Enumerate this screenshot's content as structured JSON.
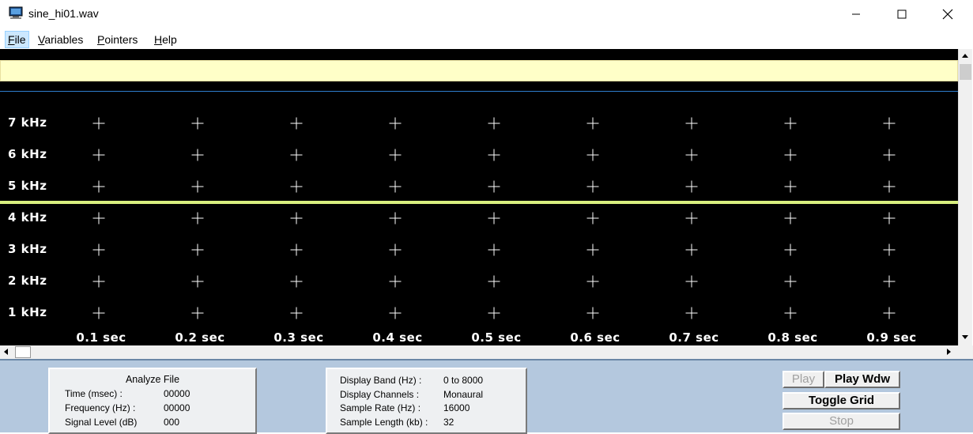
{
  "window": {
    "title": "sine_hi01.wav"
  },
  "menu": [
    {
      "label": "File",
      "ul": "F",
      "rest": "ile"
    },
    {
      "label": "Variables",
      "ul": "V",
      "rest": "ariables"
    },
    {
      "label": "Pointers",
      "ul": "P",
      "rest": "ointers"
    },
    {
      "label": "Help",
      "ul": "H",
      "rest": "elp"
    }
  ],
  "spectrogram": {
    "y_labels": [
      "7 kHz",
      "6 kHz",
      "5 kHz",
      "4 kHz",
      "3 kHz",
      "2 kHz",
      "1 kHz"
    ],
    "x_labels": [
      "0.1 sec",
      "0.2 sec",
      "0.3 sec",
      "0.4 sec",
      "0.5 sec",
      "0.6 sec",
      "0.7 sec",
      "0.8 sec",
      "0.9 sec"
    ],
    "colors": {
      "background": "#000000",
      "highlight_band": "#ffffc8",
      "blue_line": "#2f7fcf",
      "signal_line": "#d8ef7e"
    }
  },
  "analyze": {
    "title": "Analyze File",
    "rows": [
      {
        "label": "Time (msec) :",
        "value": "00000"
      },
      {
        "label": "Frequency (Hz) :",
        "value": "00000"
      },
      {
        "label": "Signal Level (dB)",
        "value": "000"
      }
    ]
  },
  "display": {
    "rows": [
      {
        "label": "Display Band (Hz) :",
        "value": "0 to 8000"
      },
      {
        "label": "Display Channels :",
        "value": "Monaural"
      },
      {
        "label": "Sample Rate (Hz) :",
        "value": "16000"
      },
      {
        "label": "Sample Length (kb) :",
        "value": "32"
      }
    ]
  },
  "buttons": {
    "play": "Play",
    "play_wdw": "Play Wdw",
    "toggle_grid": "Toggle Grid",
    "stop": "Stop"
  }
}
